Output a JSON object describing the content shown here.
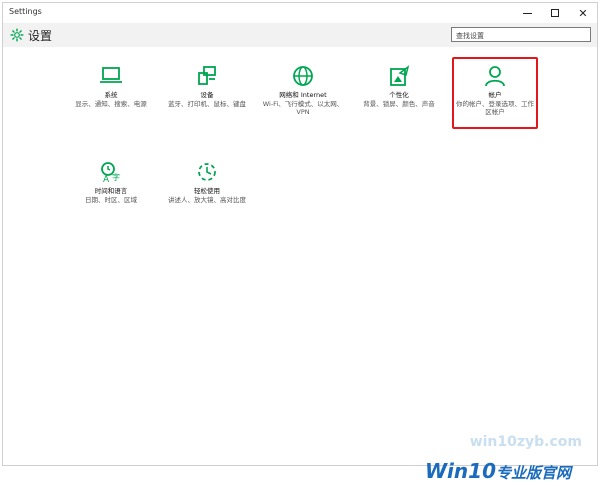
{
  "window": {
    "title": "Settings"
  },
  "header": {
    "title": "设置",
    "search_placeholder": "查找设置"
  },
  "tiles": [
    {
      "name": "系统",
      "desc": "显示、通知、搜索、电源",
      "icon": "laptop-icon"
    },
    {
      "name": "设备",
      "desc": "蓝牙、打印机、鼠标、键盘",
      "icon": "devices-icon"
    },
    {
      "name": "网络和 Internet",
      "desc": "Wi-Fi、飞行模式、以太网、VPN",
      "icon": "globe-icon"
    },
    {
      "name": "个性化",
      "desc": "背景、锁屏、颜色、声音",
      "icon": "personalization-icon"
    },
    {
      "name": "帐户",
      "desc": "你的帐户、登录选项、工作区帐户",
      "icon": "account-icon"
    },
    {
      "name": "时间和语言",
      "desc": "日期、时区、区域",
      "icon": "time-language-icon"
    },
    {
      "name": "轻松使用",
      "desc": "讲述人、放大镜、高对比度",
      "icon": "ease-of-access-icon"
    }
  ],
  "colors": {
    "accent": "#00a651",
    "highlight": "#e3161c",
    "brand": "#1a6bbd"
  },
  "watermark": {
    "site": "win10zyb.com",
    "brand_logo": "Win10",
    "brand_text": "专业版官网"
  }
}
